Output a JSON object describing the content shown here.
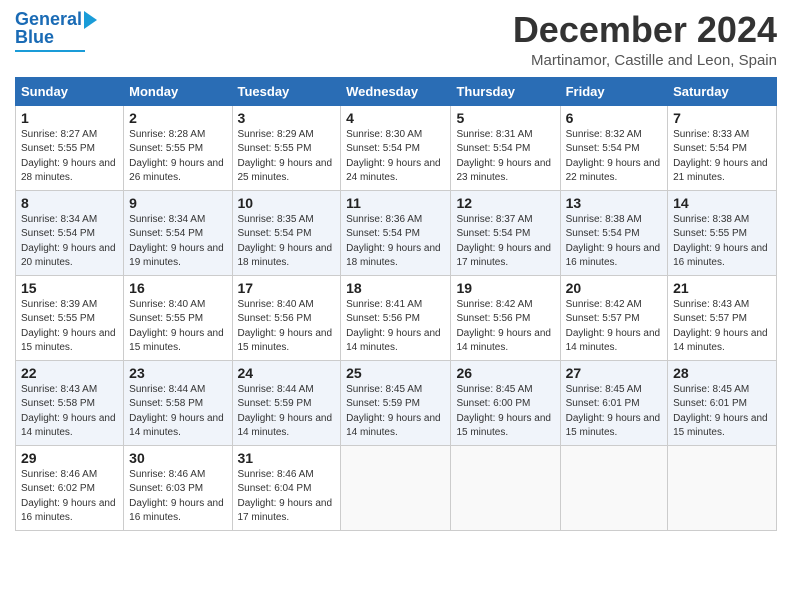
{
  "logo": {
    "line1": "General",
    "line2": "Blue"
  },
  "header": {
    "month": "December 2024",
    "location": "Martinamor, Castille and Leon, Spain"
  },
  "weekdays": [
    "Sunday",
    "Monday",
    "Tuesday",
    "Wednesday",
    "Thursday",
    "Friday",
    "Saturday"
  ],
  "weeks": [
    [
      {
        "day": "1",
        "sunrise": "8:27 AM",
        "sunset": "5:55 PM",
        "daylight": "9 hours and 28 minutes."
      },
      {
        "day": "2",
        "sunrise": "8:28 AM",
        "sunset": "5:55 PM",
        "daylight": "9 hours and 26 minutes."
      },
      {
        "day": "3",
        "sunrise": "8:29 AM",
        "sunset": "5:55 PM",
        "daylight": "9 hours and 25 minutes."
      },
      {
        "day": "4",
        "sunrise": "8:30 AM",
        "sunset": "5:54 PM",
        "daylight": "9 hours and 24 minutes."
      },
      {
        "day": "5",
        "sunrise": "8:31 AM",
        "sunset": "5:54 PM",
        "daylight": "9 hours and 23 minutes."
      },
      {
        "day": "6",
        "sunrise": "8:32 AM",
        "sunset": "5:54 PM",
        "daylight": "9 hours and 22 minutes."
      },
      {
        "day": "7",
        "sunrise": "8:33 AM",
        "sunset": "5:54 PM",
        "daylight": "9 hours and 21 minutes."
      }
    ],
    [
      {
        "day": "8",
        "sunrise": "8:34 AM",
        "sunset": "5:54 PM",
        "daylight": "9 hours and 20 minutes."
      },
      {
        "day": "9",
        "sunrise": "8:34 AM",
        "sunset": "5:54 PM",
        "daylight": "9 hours and 19 minutes."
      },
      {
        "day": "10",
        "sunrise": "8:35 AM",
        "sunset": "5:54 PM",
        "daylight": "9 hours and 18 minutes."
      },
      {
        "day": "11",
        "sunrise": "8:36 AM",
        "sunset": "5:54 PM",
        "daylight": "9 hours and 18 minutes."
      },
      {
        "day": "12",
        "sunrise": "8:37 AM",
        "sunset": "5:54 PM",
        "daylight": "9 hours and 17 minutes."
      },
      {
        "day": "13",
        "sunrise": "8:38 AM",
        "sunset": "5:54 PM",
        "daylight": "9 hours and 16 minutes."
      },
      {
        "day": "14",
        "sunrise": "8:38 AM",
        "sunset": "5:55 PM",
        "daylight": "9 hours and 16 minutes."
      }
    ],
    [
      {
        "day": "15",
        "sunrise": "8:39 AM",
        "sunset": "5:55 PM",
        "daylight": "9 hours and 15 minutes."
      },
      {
        "day": "16",
        "sunrise": "8:40 AM",
        "sunset": "5:55 PM",
        "daylight": "9 hours and 15 minutes."
      },
      {
        "day": "17",
        "sunrise": "8:40 AM",
        "sunset": "5:56 PM",
        "daylight": "9 hours and 15 minutes."
      },
      {
        "day": "18",
        "sunrise": "8:41 AM",
        "sunset": "5:56 PM",
        "daylight": "9 hours and 14 minutes."
      },
      {
        "day": "19",
        "sunrise": "8:42 AM",
        "sunset": "5:56 PM",
        "daylight": "9 hours and 14 minutes."
      },
      {
        "day": "20",
        "sunrise": "8:42 AM",
        "sunset": "5:57 PM",
        "daylight": "9 hours and 14 minutes."
      },
      {
        "day": "21",
        "sunrise": "8:43 AM",
        "sunset": "5:57 PM",
        "daylight": "9 hours and 14 minutes."
      }
    ],
    [
      {
        "day": "22",
        "sunrise": "8:43 AM",
        "sunset": "5:58 PM",
        "daylight": "9 hours and 14 minutes."
      },
      {
        "day": "23",
        "sunrise": "8:44 AM",
        "sunset": "5:58 PM",
        "daylight": "9 hours and 14 minutes."
      },
      {
        "day": "24",
        "sunrise": "8:44 AM",
        "sunset": "5:59 PM",
        "daylight": "9 hours and 14 minutes."
      },
      {
        "day": "25",
        "sunrise": "8:45 AM",
        "sunset": "5:59 PM",
        "daylight": "9 hours and 14 minutes."
      },
      {
        "day": "26",
        "sunrise": "8:45 AM",
        "sunset": "6:00 PM",
        "daylight": "9 hours and 15 minutes."
      },
      {
        "day": "27",
        "sunrise": "8:45 AM",
        "sunset": "6:01 PM",
        "daylight": "9 hours and 15 minutes."
      },
      {
        "day": "28",
        "sunrise": "8:45 AM",
        "sunset": "6:01 PM",
        "daylight": "9 hours and 15 minutes."
      }
    ],
    [
      {
        "day": "29",
        "sunrise": "8:46 AM",
        "sunset": "6:02 PM",
        "daylight": "9 hours and 16 minutes."
      },
      {
        "day": "30",
        "sunrise": "8:46 AM",
        "sunset": "6:03 PM",
        "daylight": "9 hours and 16 minutes."
      },
      {
        "day": "31",
        "sunrise": "8:46 AM",
        "sunset": "6:04 PM",
        "daylight": "9 hours and 17 minutes."
      },
      null,
      null,
      null,
      null
    ]
  ],
  "labels": {
    "sunrise": "Sunrise:",
    "sunset": "Sunset:",
    "daylight": "Daylight:"
  }
}
